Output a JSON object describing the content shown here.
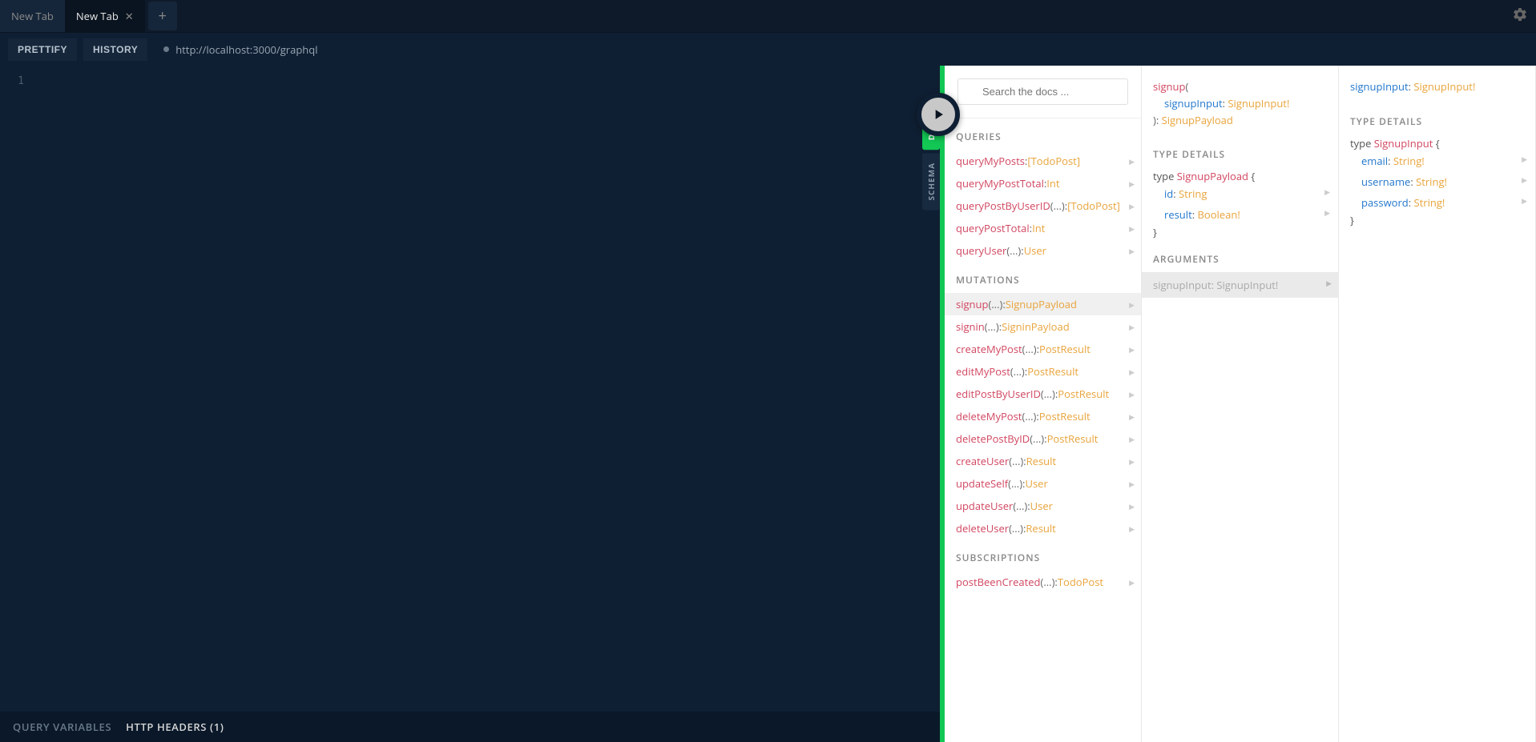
{
  "tabs": {
    "inactive": "New Tab",
    "active": "New Tab"
  },
  "toolbar": {
    "prettify": "PRETTIFY",
    "history": "HISTORY",
    "endpoint": "http://localhost:3000/graphql"
  },
  "gutter": {
    "line1": "1"
  },
  "footer": {
    "query_vars": "QUERY VARIABLES",
    "http_headers": "HTTP HEADERS (1)"
  },
  "side_tabs": {
    "docs": "DOCS",
    "schema": "SCHEMA"
  },
  "search": {
    "placeholder": "Search the docs ..."
  },
  "sections": {
    "queries": "QUERIES",
    "mutations": "MUTATIONS",
    "subscriptions": "SUBSCRIPTIONS",
    "type_details": "TYPE DETAILS",
    "arguments": "ARGUMENTS"
  },
  "queries": [
    {
      "name": "queryMyPosts",
      "args": "",
      "ret": "[TodoPost]"
    },
    {
      "name": "queryMyPostTotal",
      "args": "",
      "ret": "Int"
    },
    {
      "name": "queryPostByUserID",
      "args": "(...)",
      "ret": "[TodoPost]"
    },
    {
      "name": "queryPostTotal",
      "args": "",
      "ret": "Int"
    },
    {
      "name": "queryUser",
      "args": "(...)",
      "ret": "User"
    }
  ],
  "mutations": [
    {
      "name": "signup",
      "args": "(...)",
      "ret": "SignupPayload",
      "selected": true
    },
    {
      "name": "signin",
      "args": "(...)",
      "ret": "SigninPayload"
    },
    {
      "name": "createMyPost",
      "args": "(...)",
      "ret": "PostResult"
    },
    {
      "name": "editMyPost",
      "args": "(...)",
      "ret": "PostResult"
    },
    {
      "name": "editPostByUserID",
      "args": "(...)",
      "ret": "PostResult"
    },
    {
      "name": "deleteMyPost",
      "args": "(...)",
      "ret": "PostResult"
    },
    {
      "name": "deletePostByID",
      "args": "(...)",
      "ret": "PostResult"
    },
    {
      "name": "createUser",
      "args": "(...)",
      "ret": "Result"
    },
    {
      "name": "updateSelf",
      "args": "(...)",
      "ret": "User"
    },
    {
      "name": "updateUser",
      "args": "(...)",
      "ret": "User"
    },
    {
      "name": "deleteUser",
      "args": "(...)",
      "ret": "Result"
    }
  ],
  "subscriptions": [
    {
      "name": "postBeenCreated",
      "args": "(...)",
      "ret": "TodoPost"
    }
  ],
  "detail": {
    "sig_name": "signup",
    "sig_open": "(",
    "sig_arg_name": "signupInput",
    "sig_arg_type": "SignupInput!",
    "sig_close": "): ",
    "sig_ret": "SignupPayload",
    "type_kw": "type",
    "type_name": "SignupPayload",
    "brace_open": " {",
    "fields": [
      {
        "name": "id",
        "type": "String"
      },
      {
        "name": "result",
        "type": "Boolean!"
      }
    ],
    "brace_close": "}",
    "arg_row": "signupInput: SignupInput!"
  },
  "detail2": {
    "header_name": "signupInput",
    "header_type": "SignupInput!",
    "type_kw": "type",
    "type_name": "SignupInput",
    "brace_open": " {",
    "fields": [
      {
        "name": "email",
        "type": "String!"
      },
      {
        "name": "username",
        "type": "String!"
      },
      {
        "name": "password",
        "type": "String!"
      }
    ],
    "brace_close": "}"
  }
}
